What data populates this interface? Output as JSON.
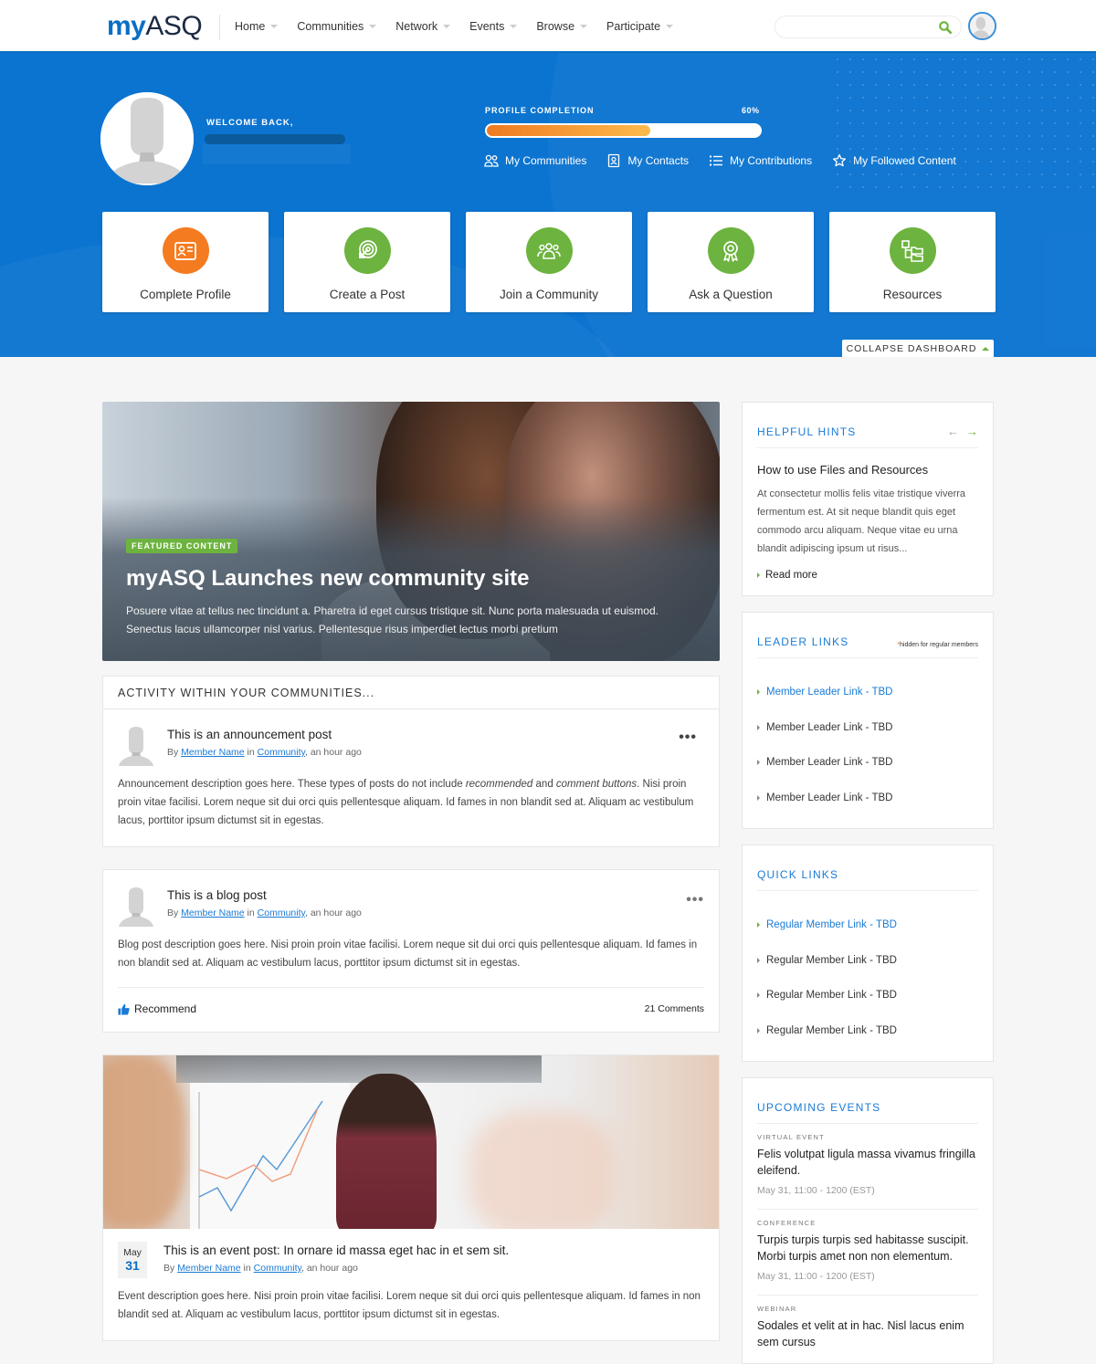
{
  "header": {
    "logo_my": "my",
    "logo_asq": "ASQ",
    "nav": [
      {
        "label": "Home"
      },
      {
        "label": "Communities"
      },
      {
        "label": "Network"
      },
      {
        "label": "Events"
      },
      {
        "label": "Browse"
      },
      {
        "label": "Participate"
      }
    ],
    "search": {
      "value": "",
      "placeholder": ""
    }
  },
  "dashboard": {
    "welcome_label": "WELCOME BACK,",
    "profile_completion": {
      "label": "PROFILE COMPLETION",
      "value_text": "60%",
      "percent": 60
    },
    "quick_nav": [
      {
        "label": "My Communities",
        "icon": "people-icon"
      },
      {
        "label": "My Contacts",
        "icon": "contact-card-icon"
      },
      {
        "label": "My Contributions",
        "icon": "list-icon"
      },
      {
        "label": "My Followed Content",
        "icon": "star-icon"
      }
    ],
    "actions": [
      {
        "label": "Complete Profile",
        "icon": "id-card-icon",
        "color": "#f47b20"
      },
      {
        "label": "Create a Post",
        "icon": "target-cursor-icon",
        "color": "#6db33f"
      },
      {
        "label": "Join a Community",
        "icon": "group-icon",
        "color": "#6db33f"
      },
      {
        "label": "Ask a Question",
        "icon": "award-ribbon-icon",
        "color": "#6db33f"
      },
      {
        "label": "Resources",
        "icon": "folder-tree-icon",
        "color": "#6db33f"
      }
    ],
    "collapse_label": "COLLAPSE DASHBOARD"
  },
  "featured": {
    "badge": "FEATURED CONTENT",
    "title": "myASQ Launches new community site",
    "description": "Posuere vitae at tellus nec tincidunt a. Pharetra id eget cursus tristique sit. Nunc porta malesuada ut euismod. Senectus lacus ullamcorper nisl varius. Pellentesque risus imperdiet lectus morbi pretium"
  },
  "activity": {
    "header": "ACTIVITY WITHIN YOUR COMMUNITIES...",
    "posts": [
      {
        "title": "This is an announcement post",
        "by": "By",
        "author": "Member Name",
        "in": "in",
        "community": "Community",
        "time": ", an hour ago",
        "body_pre": "Announcement description goes here. These types of posts do not include ",
        "body_em1": "recommended",
        "body_mid": " and ",
        "body_em2": "comment buttons",
        "body_post": ". Nisi proin proin vitae facilisi. Lorem neque sit dui orci quis pellentesque aliquam. Id fames in non blandit sed at. Aliquam ac vestibulum lacus, porttitor ipsum dictumst sit in egestas."
      },
      {
        "title": "This is a blog post",
        "by": "By",
        "author": "Member Name",
        "in": "in",
        "community": "Community",
        "time": ", an hour ago",
        "body": "Blog post description goes here. Nisi proin proin vitae facilisi. Lorem neque sit dui orci quis pellentesque aliquam. Id fames in non blandit sed at. Aliquam ac vestibulum lacus, porttitor ipsum dictumst sit in egestas.",
        "recommend_label": "Recommend",
        "comments_label": "21 Comments"
      },
      {
        "date_month": "May",
        "date_day": "31",
        "title": "This is an event post: In ornare id massa eget hac in et sem sit.",
        "by": "By",
        "author": "Member Name",
        "in": "in",
        "community": "Community",
        "time": ", an hour ago",
        "body": "Event description goes here. Nisi proin proin vitae facilisi. Lorem neque sit dui orci quis pellentesque aliquam. Id fames in non blandit sed at. Aliquam ac vestibulum lacus, porttitor ipsum dictumst sit in egestas."
      }
    ]
  },
  "sidebar": {
    "hints": {
      "title": "HELPFUL HINTS",
      "hint_title": "How to use Files and Resources",
      "hint_body": "At consectetur mollis felis vitae tristique viverra fermentum est. At sit neque blandit quis eget commodo arcu aliquam. Neque vitae eu urna blandit adipiscing ipsum ut risus...",
      "read_more": "Read more"
    },
    "leader_links": {
      "title": "LEADER LINKS",
      "note_asterisk": "*",
      "note": "hidden for regular members",
      "items": [
        {
          "label": "Member Leader Link - TBD"
        },
        {
          "label": "Member Leader Link - TBD"
        },
        {
          "label": "Member Leader Link - TBD"
        },
        {
          "label": "Member Leader Link - TBD"
        }
      ]
    },
    "quick_links": {
      "title": "QUICK LINKS",
      "items": [
        {
          "label": "Regular Member Link - TBD"
        },
        {
          "label": "Regular Member Link - TBD"
        },
        {
          "label": "Regular Member Link - TBD"
        },
        {
          "label": "Regular Member Link - TBD"
        }
      ]
    },
    "events": {
      "title": "UPCOMING EVENTS",
      "items": [
        {
          "type": "VIRTUAL EVENT",
          "title": "Felis volutpat ligula massa vivamus fringilla eleifend.",
          "time": "May 31, 11:00 - 1200 (EST)"
        },
        {
          "type": "CONFERENCE",
          "title": "Turpis turpis turpis sed habitasse suscipit. Morbi turpis amet non non elementum.",
          "time": "May 31, 11:00 - 1200 (EST)"
        },
        {
          "type": "WEBINAR",
          "title": "Sodales et velit at in hac. Nisl lacus enim sem cursus",
          "time": ""
        }
      ]
    }
  },
  "colors": {
    "brand_blue": "#0b74d0",
    "link_blue": "#1a7ad4",
    "accent_green": "#6db33f",
    "accent_orange": "#f47b20"
  }
}
